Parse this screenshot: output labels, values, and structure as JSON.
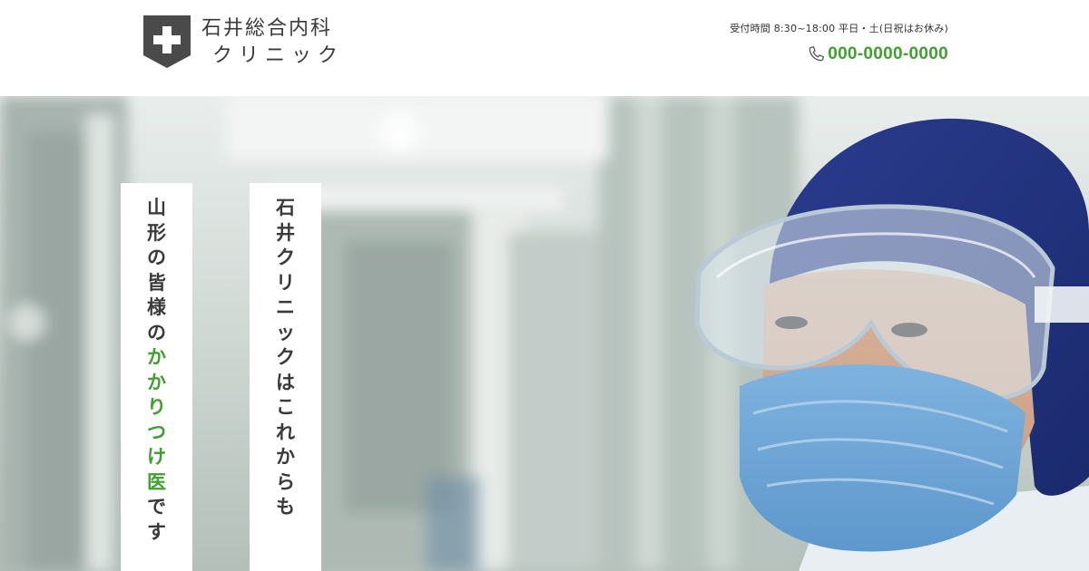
{
  "colors": {
    "accent_green": "#3f9f2f",
    "text_dark": "#3a3a3a",
    "logo_mark": "#4a4a4a",
    "card_bg": "#ffffff"
  },
  "header": {
    "clinic_name_line1": "石井総合内科",
    "clinic_name_line2": "クリニック",
    "logo_icon": "medical-cross-shield-icon",
    "reception_hours": "受付時間 8:30~18:00 平日・土(日祝はお休み)",
    "phone_icon": "phone-icon",
    "phone_number": "000-0000-0000"
  },
  "hero": {
    "image_subject": "doctor wearing blue surgical cap, safety goggles and face mask in a hospital corridor",
    "catchphrase_left": {
      "text": "山形の皆様のかかりつけ医です",
      "highlight": "かかりつけ医"
    },
    "catchphrase_right": {
      "text": "石井クリニックはこれからも"
    }
  }
}
